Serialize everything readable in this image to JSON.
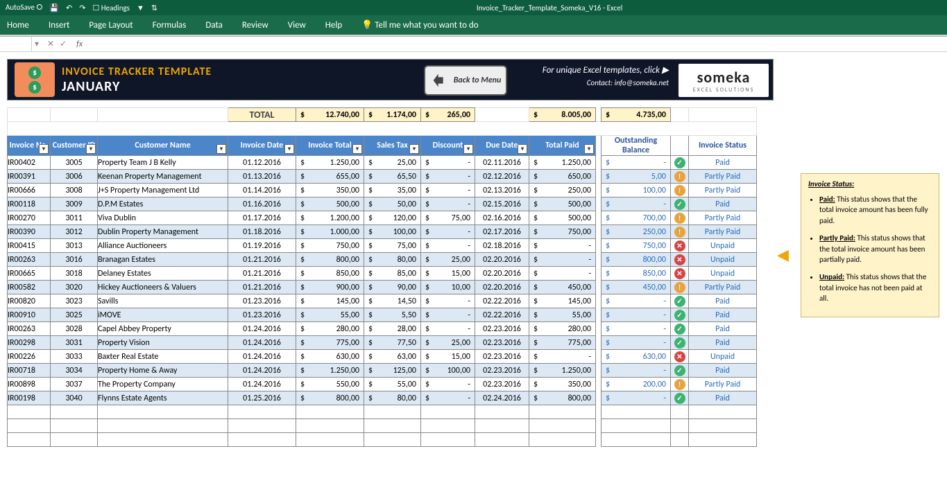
{
  "app": {
    "autosave": "AutoSave",
    "doc": "Invoice_Tracker_Template_Someka_V16  -  Excel",
    "headings": "Headings"
  },
  "ribbon": [
    "Home",
    "Insert",
    "Page Layout",
    "Formulas",
    "Data",
    "Review",
    "View",
    "Help",
    "Tell me what you want to do"
  ],
  "banner": {
    "title": "INVOICE TRACKER TEMPLATE",
    "month": "JANUARY",
    "back": "Back to Menu",
    "promo": "For unique Excel templates, click ▶",
    "contact": "Contact: info@someka.net",
    "brand": "someka",
    "brandSub": "EXCEL SOLUTIONS"
  },
  "totals": {
    "label": "TOTAL",
    "invTotal": "12.740,00",
    "tax": "1.174,00",
    "disc": "265,00",
    "paid": "8.005,00",
    "out": "4.735,00"
  },
  "headers": {
    "invno": "Invoice No.",
    "cust": "Customer ID",
    "name": "Customer Name",
    "date": "Invoice Date",
    "itot": "Invoice Total",
    "tax": "Sales Tax",
    "disc": "Discount",
    "due": "Due Date",
    "tpaid": "Total Paid",
    "out": "Outstanding Balance",
    "stat": "Invoice Status"
  },
  "rows": [
    {
      "invno": "IR00402",
      "cust": "3005",
      "name": "Property Team J B Kelly",
      "date": "01.12.2016",
      "itot": "1.250,00",
      "tax": "25,00",
      "disc": "-",
      "due": "02.11.2016",
      "paid": "1.250,00",
      "out": "-",
      "status": "Paid"
    },
    {
      "invno": "IR00391",
      "cust": "3006",
      "name": "Keenan Property Management",
      "date": "01.13.2016",
      "itot": "655,00",
      "tax": "65,50",
      "disc": "-",
      "due": "02.12.2016",
      "paid": "650,00",
      "out": "5,00",
      "status": "Partly Paid"
    },
    {
      "invno": "IR00666",
      "cust": "3008",
      "name": "J+S Property Management Ltd",
      "date": "01.14.2016",
      "itot": "350,00",
      "tax": "35,00",
      "disc": "-",
      "due": "02.13.2016",
      "paid": "250,00",
      "out": "100,00",
      "status": "Partly Paid"
    },
    {
      "invno": "IR00118",
      "cust": "3009",
      "name": "D.P.M Estates",
      "date": "01.16.2016",
      "itot": "500,00",
      "tax": "50,00",
      "disc": "-",
      "due": "02.15.2016",
      "paid": "500,00",
      "out": "-",
      "status": "Paid"
    },
    {
      "invno": "IR00270",
      "cust": "3011",
      "name": "Viva Dublin",
      "date": "01.17.2016",
      "itot": "1.200,00",
      "tax": "120,00",
      "disc": "75,00",
      "due": "02.16.2016",
      "paid": "500,00",
      "out": "700,00",
      "status": "Partly Paid"
    },
    {
      "invno": "IR00390",
      "cust": "3012",
      "name": "Dublin Property Management",
      "date": "01.18.2016",
      "itot": "1.000,00",
      "tax": "100,00",
      "disc": "-",
      "due": "02.17.2016",
      "paid": "750,00",
      "out": "250,00",
      "status": "Partly Paid"
    },
    {
      "invno": "IR00415",
      "cust": "3013",
      "name": "Alliance Auctioneers",
      "date": "01.19.2016",
      "itot": "750,00",
      "tax": "75,00",
      "disc": "-",
      "due": "02.18.2016",
      "paid": "-",
      "out": "750,00",
      "status": "Unpaid"
    },
    {
      "invno": "IR00263",
      "cust": "3016",
      "name": "Branagan Estates",
      "date": "01.21.2016",
      "itot": "800,00",
      "tax": "80,00",
      "disc": "25,00",
      "due": "02.20.2016",
      "paid": "-",
      "out": "800,00",
      "status": "Unpaid"
    },
    {
      "invno": "IR00665",
      "cust": "3018",
      "name": "Delaney Estates",
      "date": "01.21.2016",
      "itot": "850,00",
      "tax": "85,00",
      "disc": "15,00",
      "due": "02.20.2016",
      "paid": "-",
      "out": "850,00",
      "status": "Unpaid"
    },
    {
      "invno": "IR00582",
      "cust": "3020",
      "name": "Hickey Auctioneers & Valuers",
      "date": "01.21.2016",
      "itot": "900,00",
      "tax": "90,00",
      "disc": "10,00",
      "due": "02.20.2016",
      "paid": "450,00",
      "out": "450,00",
      "status": "Partly Paid"
    },
    {
      "invno": "IR00820",
      "cust": "3023",
      "name": "Savills",
      "date": "01.23.2016",
      "itot": "145,00",
      "tax": "14,50",
      "disc": "-",
      "due": "02.22.2016",
      "paid": "145,00",
      "out": "-",
      "status": "Paid"
    },
    {
      "invno": "IR00910",
      "cust": "3025",
      "name": "iMOVE",
      "date": "01.23.2016",
      "itot": "55,00",
      "tax": "5,50",
      "disc": "-",
      "due": "02.22.2016",
      "paid": "55,00",
      "out": "-",
      "status": "Paid"
    },
    {
      "invno": "IR00263",
      "cust": "3028",
      "name": "Capel Abbey Property",
      "date": "01.24.2016",
      "itot": "280,00",
      "tax": "28,00",
      "disc": "-",
      "due": "02.23.2016",
      "paid": "280,00",
      "out": "-",
      "status": "Paid"
    },
    {
      "invno": "IR00298",
      "cust": "3031",
      "name": "Property Vision",
      "date": "01.24.2016",
      "itot": "775,00",
      "tax": "77,50",
      "disc": "25,00",
      "due": "02.23.2016",
      "paid": "775,00",
      "out": "-",
      "status": "Paid"
    },
    {
      "invno": "IR00226",
      "cust": "3033",
      "name": "Baxter Real Estate",
      "date": "01.24.2016",
      "itot": "630,00",
      "tax": "63,00",
      "disc": "15,00",
      "due": "02.23.2016",
      "paid": "-",
      "out": "630,00",
      "status": "Unpaid"
    },
    {
      "invno": "IR00718",
      "cust": "3034",
      "name": "Property Home & Away",
      "date": "01.24.2016",
      "itot": "1.250,00",
      "tax": "125,00",
      "disc": "100,00",
      "due": "02.23.2016",
      "paid": "1.250,00",
      "out": "-",
      "status": "Paid"
    },
    {
      "invno": "IR00898",
      "cust": "3037",
      "name": "The Property Company",
      "date": "01.24.2016",
      "itot": "550,00",
      "tax": "55,00",
      "disc": "-",
      "due": "02.23.2016",
      "paid": "350,00",
      "out": "200,00",
      "status": "Partly Paid"
    },
    {
      "invno": "IR00198",
      "cust": "3040",
      "name": "Flynns Estate Agents",
      "date": "01.25.2016",
      "itot": "800,00",
      "tax": "80,00",
      "disc": "-",
      "due": "02.24.2016",
      "paid": "800,00",
      "out": "-",
      "status": "Paid"
    }
  ],
  "info": {
    "title": "Invoice Status:",
    "paid": "Paid:",
    "paidTxt": " This status shows that the total invoice amount has been fully paid.",
    "partly": "Partly Paid:",
    "partlyTxt": " This status shows that the total invoice amount has been partially paid.",
    "unpaid": "Unpaid:",
    "unpaidTxt": " This status shows that the total invoice has not been paid at all."
  }
}
